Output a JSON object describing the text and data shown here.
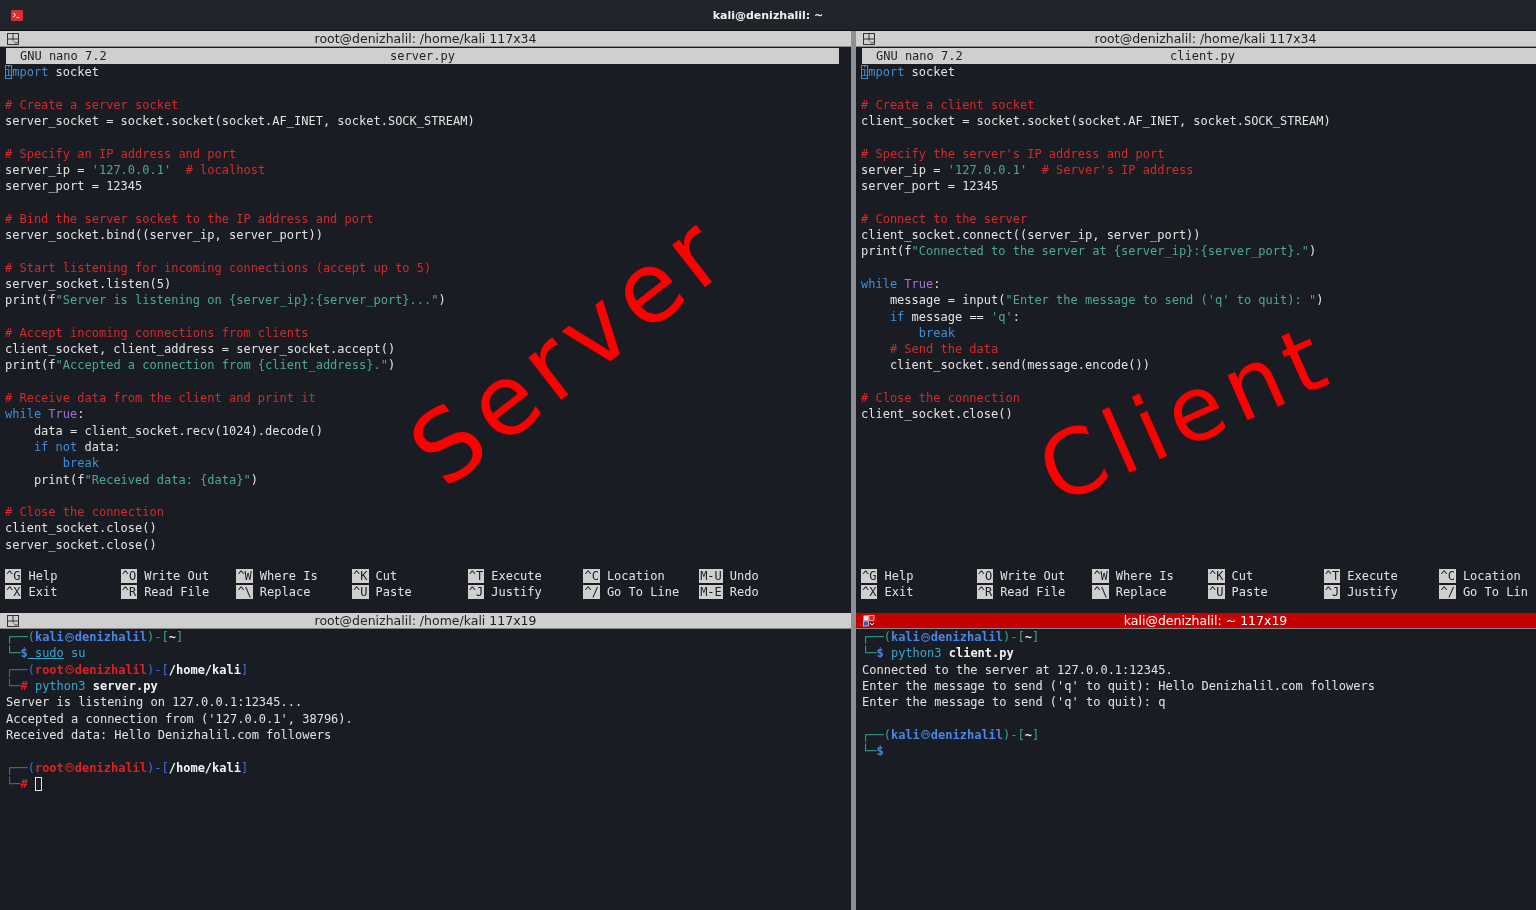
{
  "window": {
    "title": "kali@denizhalil: ~"
  },
  "panes": [
    {
      "kind": "nano",
      "header": {
        "title": "root@denizhalil: /home/kali 117x34",
        "active": false
      },
      "nano_version": "GNU nano 7.2",
      "filename": "server.py",
      "annotation": "Server",
      "lines": [
        {
          "kind": "text",
          "segments": [
            {
              "kind": "cursor",
              "text": "i"
            },
            {
              "kind": "kw",
              "text": "mport"
            },
            {
              "kind": "plain",
              "text": " socket"
            }
          ]
        },
        {
          "kind": "blank"
        },
        {
          "kind": "text",
          "segments": [
            {
              "kind": "com",
              "text": "# Create a server socket"
            }
          ]
        },
        {
          "kind": "text",
          "segments": [
            {
              "kind": "plain",
              "text": "server_socket = socket.socket(socket.AF_INET, socket.SOCK_STREAM)"
            }
          ]
        },
        {
          "kind": "blank"
        },
        {
          "kind": "text",
          "segments": [
            {
              "kind": "com",
              "text": "# Specify an IP address and port"
            }
          ]
        },
        {
          "kind": "text",
          "segments": [
            {
              "kind": "plain",
              "text": "server_ip = "
            },
            {
              "kind": "str",
              "text": "'127.0.0.1'"
            },
            {
              "kind": "com",
              "text": "  # localhost"
            }
          ]
        },
        {
          "kind": "text",
          "segments": [
            {
              "kind": "plain",
              "text": "server_port = 12345"
            }
          ]
        },
        {
          "kind": "blank"
        },
        {
          "kind": "text",
          "segments": [
            {
              "kind": "com",
              "text": "# Bind the server socket to the IP address and port"
            }
          ]
        },
        {
          "kind": "text",
          "segments": [
            {
              "kind": "plain",
              "text": "server_socket.bind((server_ip, server_port))"
            }
          ]
        },
        {
          "kind": "blank"
        },
        {
          "kind": "text",
          "segments": [
            {
              "kind": "com",
              "text": "# Start listening for incoming connections (accept up to 5)"
            }
          ]
        },
        {
          "kind": "text",
          "segments": [
            {
              "kind": "plain",
              "text": "server_socket.listen(5)"
            }
          ]
        },
        {
          "kind": "text",
          "segments": [
            {
              "kind": "plain",
              "text": "print(f"
            },
            {
              "kind": "str",
              "text": "\"Server is listening on {server_ip}:{server_port}...\""
            },
            {
              "kind": "plain",
              "text": ")"
            }
          ]
        },
        {
          "kind": "blank"
        },
        {
          "kind": "text",
          "segments": [
            {
              "kind": "com",
              "text": "# Accept incoming connections from clients"
            }
          ]
        },
        {
          "kind": "text",
          "segments": [
            {
              "kind": "plain",
              "text": "client_socket, client_address = server_socket.accept()"
            }
          ]
        },
        {
          "kind": "text",
          "segments": [
            {
              "kind": "plain",
              "text": "print(f"
            },
            {
              "kind": "str",
              "text": "\"Accepted a connection from {client_address}.\""
            },
            {
              "kind": "plain",
              "text": ")"
            }
          ]
        },
        {
          "kind": "blank"
        },
        {
          "kind": "text",
          "segments": [
            {
              "kind": "com",
              "text": "# Receive data from the client and print it"
            }
          ]
        },
        {
          "kind": "text",
          "segments": [
            {
              "kind": "kw",
              "text": "while"
            },
            {
              "kind": "const",
              "text": " True"
            },
            {
              "kind": "plain",
              "text": ":"
            }
          ]
        },
        {
          "kind": "text",
          "segments": [
            {
              "kind": "plain",
              "text": "    data = client_socket.recv(1024).decode()"
            }
          ]
        },
        {
          "kind": "text",
          "segments": [
            {
              "kind": "kw",
              "text": "    if not"
            },
            {
              "kind": "plain",
              "text": " data:"
            }
          ]
        },
        {
          "kind": "text",
          "segments": [
            {
              "kind": "kw",
              "text": "        break"
            }
          ]
        },
        {
          "kind": "text",
          "segments": [
            {
              "kind": "plain",
              "text": "    print(f"
            },
            {
              "kind": "str",
              "text": "\"Received data: {data}\""
            },
            {
              "kind": "plain",
              "text": ")"
            }
          ]
        },
        {
          "kind": "blank"
        },
        {
          "kind": "text",
          "segments": [
            {
              "kind": "com",
              "text": "# Close the connection"
            }
          ]
        },
        {
          "kind": "text",
          "segments": [
            {
              "kind": "plain",
              "text": "client_socket.close()"
            }
          ]
        },
        {
          "kind": "text",
          "segments": [
            {
              "kind": "plain",
              "text": "server_socket.close()"
            }
          ]
        }
      ],
      "shortcuts": [
        [
          {
            "key": "^G",
            "label": "Help"
          },
          {
            "key": "^X",
            "label": "Exit"
          }
        ],
        [
          {
            "key": "^O",
            "label": "Write Out"
          },
          {
            "key": "^R",
            "label": "Read File"
          }
        ],
        [
          {
            "key": "^W",
            "label": "Where Is"
          },
          {
            "key": "^\\",
            "label": "Replace"
          }
        ],
        [
          {
            "key": "^K",
            "label": "Cut"
          },
          {
            "key": "^U",
            "label": "Paste"
          }
        ],
        [
          {
            "key": "^T",
            "label": "Execute"
          },
          {
            "key": "^J",
            "label": "Justify"
          }
        ],
        [
          {
            "key": "^C",
            "label": "Location"
          },
          {
            "key": "^/",
            "label": "Go To Line"
          }
        ],
        [
          {
            "key": "M-U",
            "label": "Undo"
          },
          {
            "key": "M-E",
            "label": "Redo"
          }
        ]
      ]
    },
    {
      "kind": "nano",
      "header": {
        "title": "root@denizhalil: /home/kali 117x34",
        "active": false
      },
      "nano_version": "GNU nano 7.2",
      "filename": "client.py",
      "annotation": "Client",
      "lines": [
        {
          "kind": "text",
          "segments": [
            {
              "kind": "cursor",
              "text": "i"
            },
            {
              "kind": "kw",
              "text": "mport"
            },
            {
              "kind": "plain",
              "text": " socket"
            }
          ]
        },
        {
          "kind": "blank"
        },
        {
          "kind": "text",
          "segments": [
            {
              "kind": "com",
              "text": "# Create a client socket"
            }
          ]
        },
        {
          "kind": "text",
          "segments": [
            {
              "kind": "plain",
              "text": "client_socket = socket.socket(socket.AF_INET, socket.SOCK_STREAM)"
            }
          ]
        },
        {
          "kind": "blank"
        },
        {
          "kind": "text",
          "segments": [
            {
              "kind": "com",
              "text": "# Specify the server's IP address and port"
            }
          ]
        },
        {
          "kind": "text",
          "segments": [
            {
              "kind": "plain",
              "text": "server_ip = "
            },
            {
              "kind": "str",
              "text": "'127.0.0.1'"
            },
            {
              "kind": "com",
              "text": "  # Server's IP address"
            }
          ]
        },
        {
          "kind": "text",
          "segments": [
            {
              "kind": "plain",
              "text": "server_port = 12345"
            }
          ]
        },
        {
          "kind": "blank"
        },
        {
          "kind": "text",
          "segments": [
            {
              "kind": "com",
              "text": "# Connect to the server"
            }
          ]
        },
        {
          "kind": "text",
          "segments": [
            {
              "kind": "plain",
              "text": "client_socket.connect((server_ip, server_port))"
            }
          ]
        },
        {
          "kind": "text",
          "segments": [
            {
              "kind": "plain",
              "text": "print(f"
            },
            {
              "kind": "str",
              "text": "\"Connected to the server at {server_ip}:{server_port}.\""
            },
            {
              "kind": "plain",
              "text": ")"
            }
          ]
        },
        {
          "kind": "blank"
        },
        {
          "kind": "text",
          "segments": [
            {
              "kind": "kw",
              "text": "while"
            },
            {
              "kind": "const",
              "text": " True"
            },
            {
              "kind": "plain",
              "text": ":"
            }
          ]
        },
        {
          "kind": "text",
          "segments": [
            {
              "kind": "plain",
              "text": "    message = input("
            },
            {
              "kind": "str",
              "text": "\"Enter the message to send ('q' to quit): \""
            },
            {
              "kind": "plain",
              "text": ")"
            }
          ]
        },
        {
          "kind": "text",
          "segments": [
            {
              "kind": "kw",
              "text": "    if"
            },
            {
              "kind": "plain",
              "text": " message == "
            },
            {
              "kind": "str",
              "text": "'q'"
            },
            {
              "kind": "plain",
              "text": ":"
            }
          ]
        },
        {
          "kind": "text",
          "segments": [
            {
              "kind": "kw",
              "text": "        break"
            }
          ]
        },
        {
          "kind": "text",
          "segments": [
            {
              "kind": "com",
              "text": "    # Send the data"
            }
          ]
        },
        {
          "kind": "text",
          "segments": [
            {
              "kind": "plain",
              "text": "    client_socket.send(message.encode())"
            }
          ]
        },
        {
          "kind": "blank"
        },
        {
          "kind": "text",
          "segments": [
            {
              "kind": "com",
              "text": "# Close the connection"
            }
          ]
        },
        {
          "kind": "text",
          "segments": [
            {
              "kind": "plain",
              "text": "client_socket.close()"
            }
          ]
        }
      ],
      "shortcuts": [
        [
          {
            "key": "^G",
            "label": "Help"
          },
          {
            "key": "^X",
            "label": "Exit"
          }
        ],
        [
          {
            "key": "^O",
            "label": "Write Out"
          },
          {
            "key": "^R",
            "label": "Read File"
          }
        ],
        [
          {
            "key": "^W",
            "label": "Where Is"
          },
          {
            "key": "^\\",
            "label": "Replace"
          }
        ],
        [
          {
            "key": "^K",
            "label": "Cut"
          },
          {
            "key": "^U",
            "label": "Paste"
          }
        ],
        [
          {
            "key": "^T",
            "label": "Execute"
          },
          {
            "key": "^J",
            "label": "Justify"
          }
        ],
        [
          {
            "key": "^C",
            "label": "Location"
          },
          {
            "key": "^/",
            "label": "Go To Lin"
          }
        ]
      ]
    },
    {
      "kind": "shell",
      "header": {
        "title": "root@denizhalil: /home/kali 117x19",
        "active": false
      },
      "lines": [
        {
          "kind": "prompt",
          "segments": [
            {
              "kind": "frame",
              "text": "┌──("
            },
            {
              "kind": "user",
              "text": "kali"
            },
            {
              "kind": "at-user"
            },
            {
              "kind": "user",
              "text": "denizhalil"
            },
            {
              "kind": "frame",
              "text": ")-["
            },
            {
              "kind": "path",
              "text": "~"
            },
            {
              "kind": "frame",
              "text": "]"
            }
          ]
        },
        {
          "kind": "prompt",
          "segments": [
            {
              "kind": "frame",
              "text": "└─"
            },
            {
              "kind": "user",
              "text": "$"
            },
            {
              "kind": "cmd-u",
              "text": " sudo"
            },
            {
              "kind": "cmd",
              "text": " su"
            }
          ]
        },
        {
          "kind": "prompt",
          "segments": [
            {
              "kind": "frame2",
              "text": "┌──("
            },
            {
              "kind": "root",
              "text": "root"
            },
            {
              "kind": "at-root"
            },
            {
              "kind": "root",
              "text": "denizhalil"
            },
            {
              "kind": "frame2",
              "text": ")-["
            },
            {
              "kind": "path",
              "text": "/home/kali"
            },
            {
              "kind": "frame2",
              "text": "]"
            }
          ]
        },
        {
          "kind": "prompt",
          "segments": [
            {
              "kind": "frame2",
              "text": "└─"
            },
            {
              "kind": "root",
              "text": "#"
            },
            {
              "kind": "cmd",
              "text": " python3"
            },
            {
              "kind": "path",
              "text": " server.py"
            }
          ]
        },
        {
          "kind": "text",
          "segments": [
            {
              "kind": "plain",
              "text": "Server is listening on 127.0.0.1:12345..."
            }
          ]
        },
        {
          "kind": "text",
          "segments": [
            {
              "kind": "plain",
              "text": "Accepted a connection from ('127.0.0.1', 38796)."
            }
          ]
        },
        {
          "kind": "text",
          "segments": [
            {
              "kind": "plain",
              "text": "Received data: Hello Denizhalil.com followers"
            }
          ]
        },
        {
          "kind": "blank"
        },
        {
          "kind": "prompt",
          "segments": [
            {
              "kind": "frame2",
              "text": "┌──("
            },
            {
              "kind": "root",
              "text": "root"
            },
            {
              "kind": "at-root"
            },
            {
              "kind": "root",
              "text": "denizhalil"
            },
            {
              "kind": "frame2",
              "text": ")-["
            },
            {
              "kind": "path",
              "text": "/home/kali"
            },
            {
              "kind": "frame2",
              "text": "]"
            }
          ]
        },
        {
          "kind": "prompt",
          "cursor": true,
          "segments": [
            {
              "kind": "frame2",
              "text": "└─"
            },
            {
              "kind": "root",
              "text": "#"
            }
          ]
        }
      ]
    },
    {
      "kind": "shell",
      "header": {
        "title": "kali@denizhalil: ~ 117x19",
        "active": true
      },
      "lines": [
        {
          "kind": "prompt",
          "segments": [
            {
              "kind": "frame",
              "text": "┌──("
            },
            {
              "kind": "user",
              "text": "kali"
            },
            {
              "kind": "at-user"
            },
            {
              "kind": "user",
              "text": "denizhalil"
            },
            {
              "kind": "frame",
              "text": ")-["
            },
            {
              "kind": "path",
              "text": "~"
            },
            {
              "kind": "frame",
              "text": "]"
            }
          ]
        },
        {
          "kind": "prompt",
          "segments": [
            {
              "kind": "frame",
              "text": "└─"
            },
            {
              "kind": "user",
              "text": "$"
            },
            {
              "kind": "cmd",
              "text": " python3"
            },
            {
              "kind": "path",
              "text": " client.py"
            }
          ]
        },
        {
          "kind": "text",
          "segments": [
            {
              "kind": "plain",
              "text": "Connected to the server at 127.0.0.1:12345."
            }
          ]
        },
        {
          "kind": "text",
          "segments": [
            {
              "kind": "plain",
              "text": "Enter the message to send ('q' to quit): Hello Denizhalil.com followers"
            }
          ]
        },
        {
          "kind": "text",
          "segments": [
            {
              "kind": "plain",
              "text": "Enter the message to send ('q' to quit): q"
            }
          ]
        },
        {
          "kind": "blank"
        },
        {
          "kind": "prompt",
          "segments": [
            {
              "kind": "frame",
              "text": "┌──("
            },
            {
              "kind": "user",
              "text": "kali"
            },
            {
              "kind": "at-user"
            },
            {
              "kind": "user",
              "text": "denizhalil"
            },
            {
              "kind": "frame",
              "text": ")-["
            },
            {
              "kind": "path",
              "text": "~"
            },
            {
              "kind": "frame",
              "text": "]"
            }
          ]
        },
        {
          "kind": "prompt",
          "segments": [
            {
              "kind": "frame",
              "text": "└─"
            },
            {
              "kind": "user",
              "text": "$"
            }
          ]
        }
      ]
    }
  ]
}
